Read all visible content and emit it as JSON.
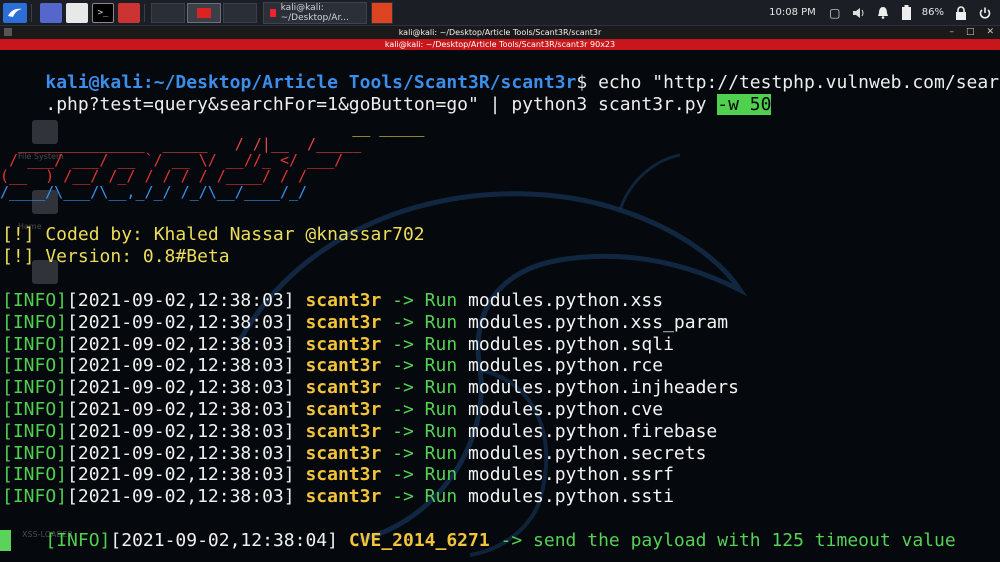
{
  "taskbar": {
    "task_title": "kali@kali: ~/Desktop/Ar...",
    "clock": "10:08 PM",
    "battery": "86%",
    "term_glyph": ">_"
  },
  "window": {
    "title": "kali@kali: ~/Desktop/Article Tools/Scant3R/scant3r",
    "subtitle": "kali@kali: ~/Desktop/Article Tools/Scant3R/scant3r 90x23"
  },
  "terminal": {
    "prompt_user": "kali@kali",
    "prompt_path": ":~/Desktop/Article Tools/Scant3R/scant3r",
    "prompt_sym": "$",
    "command_line1": " echo \"http://testphp.vulnweb.com/search",
    "command_line2": ".php?test=query&searchFor=1&goButton=go\" | python3 scant3r.py ",
    "command_flag": "-w 50",
    "banner": [
      "                                       __ _____",
      "  ______________  _____   / /|__  /_____",
      " / ___/ ___/ __ `/ __ \\/ __//_ </ ___/",
      "(__  ) /__/ /_/ / / / / /____/ / /",
      "/____/\\___/\\__,_/_/ /_/\\__/____/_/"
    ],
    "coded_by": "[!] Coded by: Khaled Nassar @knassar702",
    "version": "[!] Version: 0.8#Beta",
    "log_prefix": "[INFO]",
    "log_lines": [
      {
        "ts": "[2021-09-02,12:38:03]",
        "tool": "scant3r",
        "arrow": " -> ",
        "run": "Run",
        "mod": " modules.python.xss"
      },
      {
        "ts": "[2021-09-02,12:38:03]",
        "tool": "scant3r",
        "arrow": " -> ",
        "run": "Run",
        "mod": " modules.python.xss_param"
      },
      {
        "ts": "[2021-09-02,12:38:03]",
        "tool": "scant3r",
        "arrow": " -> ",
        "run": "Run",
        "mod": " modules.python.sqli"
      },
      {
        "ts": "[2021-09-02,12:38:03]",
        "tool": "scant3r",
        "arrow": " -> ",
        "run": "Run",
        "mod": " modules.python.rce"
      },
      {
        "ts": "[2021-09-02,12:38:03]",
        "tool": "scant3r",
        "arrow": " -> ",
        "run": "Run",
        "mod": " modules.python.injheaders"
      },
      {
        "ts": "[2021-09-02,12:38:03]",
        "tool": "scant3r",
        "arrow": " -> ",
        "run": "Run",
        "mod": " modules.python.cve"
      },
      {
        "ts": "[2021-09-02,12:38:03]",
        "tool": "scant3r",
        "arrow": " -> ",
        "run": "Run",
        "mod": " modules.python.firebase"
      },
      {
        "ts": "[2021-09-02,12:38:03]",
        "tool": "scant3r",
        "arrow": " -> ",
        "run": "Run",
        "mod": " modules.python.secrets"
      },
      {
        "ts": "[2021-09-02,12:38:03]",
        "tool": "scant3r",
        "arrow": " -> ",
        "run": "Run",
        "mod": " modules.python.ssrf"
      },
      {
        "ts": "[2021-09-02,12:38:03]",
        "tool": "scant3r",
        "arrow": " -> ",
        "run": "Run",
        "mod": " modules.python.ssti"
      }
    ],
    "last_line": {
      "ts": "[2021-09-02,12:38:04]",
      "cve": "CVE_2014_6271",
      "tail": " -> send the payload with 125 timeout value"
    }
  },
  "desktop": {
    "labels": [
      "File System",
      "Home",
      "XSS-LOADER"
    ]
  },
  "colors": {
    "info": "#4fd04f",
    "tool": "#f2c43a",
    "prompt": "#3b8eea",
    "banner_red": "#e23535",
    "banner_blue": "#3a8ff0"
  }
}
